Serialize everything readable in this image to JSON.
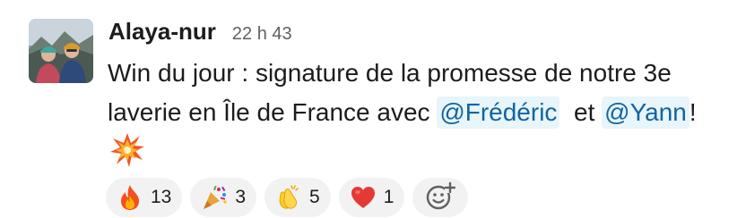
{
  "message": {
    "author": "Alaya-nur",
    "timestamp": "22 h 43",
    "avatar_icon": "profile-photo",
    "line1": "Win du jour : signature de la promesse de notre 3e",
    "line2_prefix": "laverie en Île de France avec ",
    "mention1": "@Frédéric",
    "line2_middle": "  et ",
    "mention2": "@Yann",
    "line2_suffix": "!",
    "trailing_emoji": "collision-emoji"
  },
  "reactions": [
    {
      "icon": "fire-emoji",
      "count": "13"
    },
    {
      "icon": "party-popper-emoji",
      "count": "3"
    },
    {
      "icon": "clapping-hands-emoji",
      "count": "5"
    },
    {
      "icon": "red-heart-emoji",
      "count": "1"
    }
  ],
  "add_reaction_icon": "add-reaction-icon",
  "colors": {
    "text": "#1d1c1d",
    "timestamp": "#616061",
    "mention_text": "#1264a3",
    "mention_bg": "#e8f5fa",
    "reaction_bg": "#f2f2f2"
  }
}
